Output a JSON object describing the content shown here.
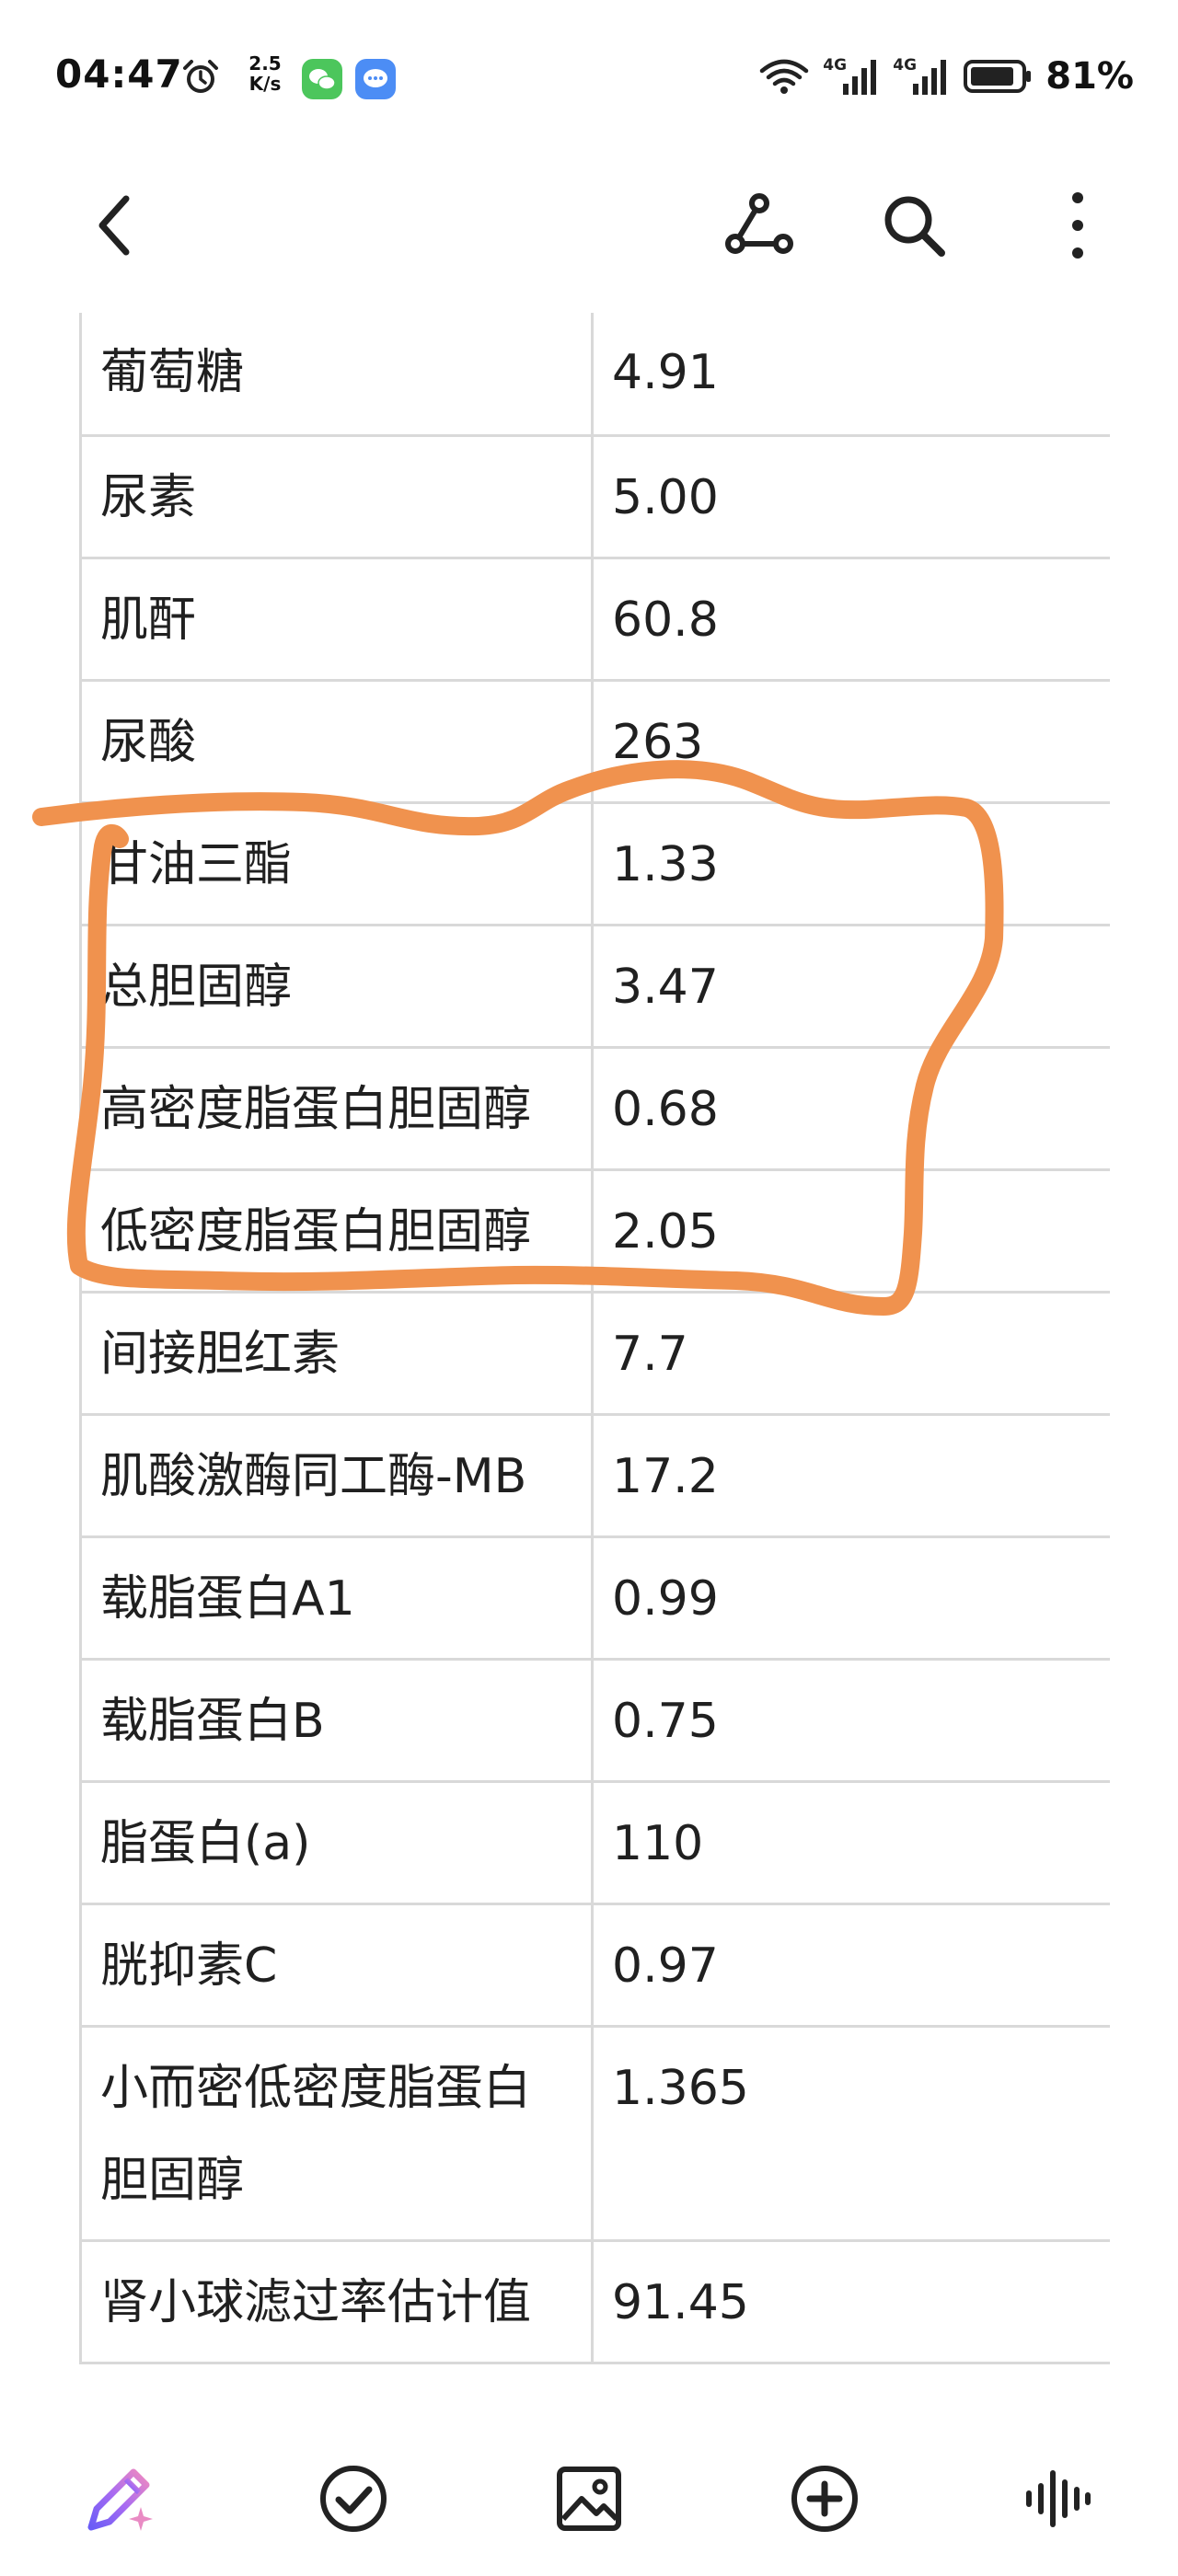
{
  "status_bar": {
    "time": "04:47",
    "net_speed_value": "2.5",
    "net_speed_unit": "K/s",
    "network_1": "4G",
    "network_2": "4G",
    "battery": "81%"
  },
  "table": {
    "rows": [
      {
        "name": "葡萄糖",
        "value": "4.91"
      },
      {
        "name": "尿素",
        "value": "5.00"
      },
      {
        "name": "肌酐",
        "value": "60.8"
      },
      {
        "name": "尿酸",
        "value": "263"
      },
      {
        "name": "甘油三酯",
        "value": "1.33"
      },
      {
        "name": "总胆固醇",
        "value": "3.47"
      },
      {
        "name": "高密度脂蛋白胆固醇",
        "value": "0.68"
      },
      {
        "name": "低密度脂蛋白胆固醇",
        "value": "2.05"
      },
      {
        "name": "间接胆红素",
        "value": "7.7"
      },
      {
        "name": "肌酸激酶同工酶-MB",
        "value": "17.2"
      },
      {
        "name": "载脂蛋白A1",
        "value": "0.99"
      },
      {
        "name": "载脂蛋白B",
        "value": "0.75"
      },
      {
        "name": "脂蛋白(a)",
        "value": "110"
      },
      {
        "name": "胱抑素C",
        "value": "0.97"
      },
      {
        "name": "小而密低密度脂蛋白胆固醇",
        "value": "1.365"
      },
      {
        "name": "肾小球滤过率估计值",
        "value": "91.45"
      }
    ]
  },
  "annotation": {
    "color": "#f0924e"
  },
  "icons": {
    "back": "back-arrow-icon",
    "share": "share-node-icon",
    "search": "search-icon",
    "more": "more-vertical-icon",
    "ai": "ai-pen-sparkle-icon",
    "check": "check-circle-icon",
    "image": "image-icon",
    "add": "add-circle-icon",
    "voice": "voice-wave-icon"
  }
}
